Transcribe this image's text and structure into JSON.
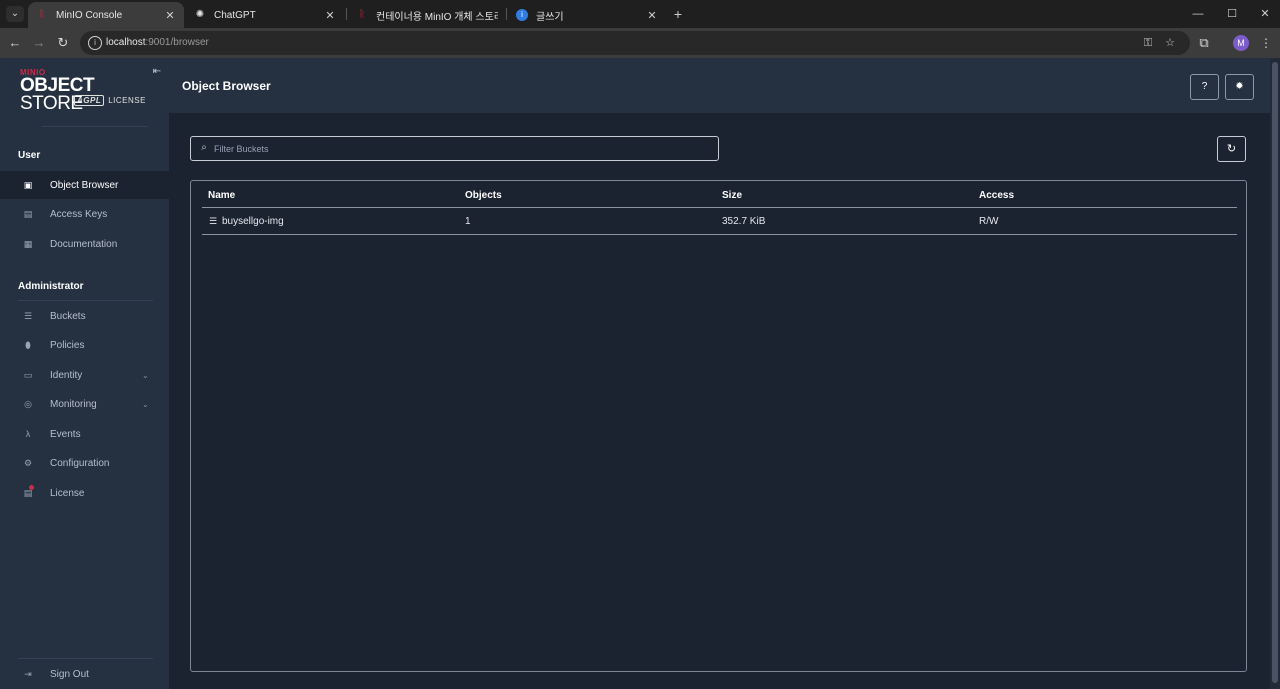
{
  "browser": {
    "tabs": [
      {
        "title": "MinIO Console",
        "active": true
      },
      {
        "title": "ChatGPT",
        "active": false
      },
      {
        "title": "컨테이너용 MinIO 개체 스토리",
        "active": false
      },
      {
        "title": "글쓰기",
        "active": false
      }
    ],
    "url_host": "localhost",
    "url_rest": ":9001/browser"
  },
  "logo": {
    "brand": "MINIO",
    "product_bold": "OBJECT",
    "product_light": " STORE",
    "license_badge": "AGPL",
    "license_text": "LICENSE"
  },
  "sidebar": {
    "user_section": "User",
    "user_items": [
      {
        "label": "Object Browser",
        "icon": "object-browser-icon",
        "active": true
      },
      {
        "label": "Access Keys",
        "icon": "access-keys-icon"
      },
      {
        "label": "Documentation",
        "icon": "documentation-icon"
      }
    ],
    "admin_section": "Administrator",
    "admin_items": [
      {
        "label": "Buckets",
        "icon": "buckets-icon"
      },
      {
        "label": "Policies",
        "icon": "policies-icon"
      },
      {
        "label": "Identity",
        "icon": "identity-icon",
        "expandable": true
      },
      {
        "label": "Monitoring",
        "icon": "monitoring-icon",
        "expandable": true
      },
      {
        "label": "Events",
        "icon": "lambda-icon"
      },
      {
        "label": "Configuration",
        "icon": "gear-icon"
      },
      {
        "label": "License",
        "icon": "license-icon"
      }
    ],
    "sign_out": "Sign Out"
  },
  "header": {
    "title": "Object Browser"
  },
  "filter": {
    "placeholder": "Filter Buckets"
  },
  "table": {
    "columns": [
      "Name",
      "Objects",
      "Size",
      "Access"
    ],
    "rows": [
      {
        "name": "buysellgo-img",
        "objects": "1",
        "size": "352.7 KiB",
        "access": "R/W"
      }
    ]
  },
  "colors": {
    "sidebar_bg": "#253040",
    "content_bg": "#1b2230",
    "brand_red": "#c72e49"
  }
}
